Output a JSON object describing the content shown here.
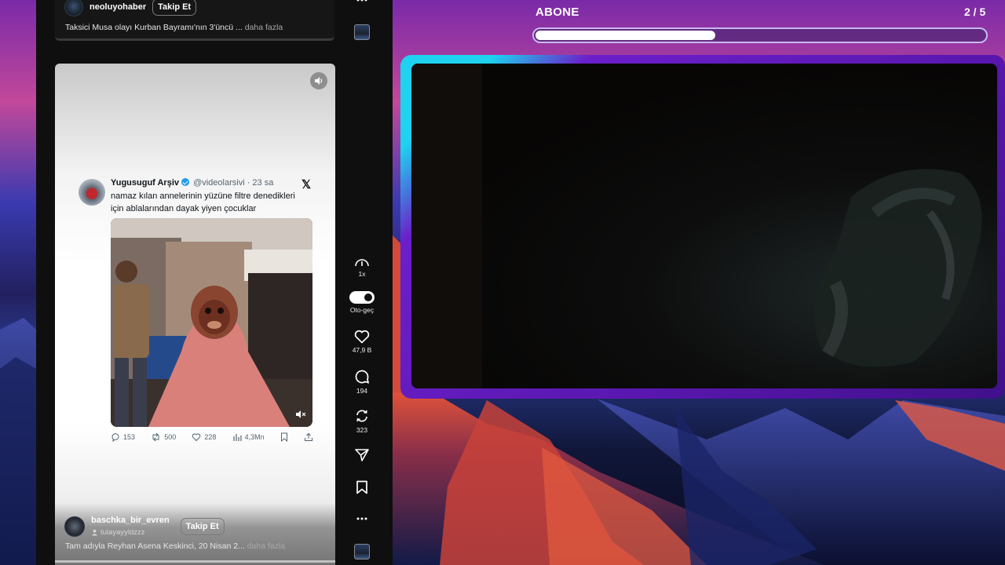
{
  "prev_card": {
    "author": "neoluyohaber",
    "follow_label": "Takip Et",
    "caption": "Taksici Musa olayı Kurban Bayramı'nın 3'üncü ...",
    "more_label": "daha fazla"
  },
  "tweet": {
    "name": "Yugusuguf Arşiv",
    "handle": "@videolarsivi",
    "time": "· 23 sa",
    "text": "namaz kılan annelerinin yüzüne filtre denedikleri için ablalarından dayak yiyen çocuklar",
    "replies": "153",
    "retweets": "500",
    "likes": "228",
    "views": "4,3Mn"
  },
  "next_card": {
    "author": "baschka_bir_evren",
    "sub": "tulayayyldzzz",
    "follow_label": "Takip Et",
    "caption": "Tam adıyla Reyhan Asena Keskinci, 20 Nisan 2...",
    "more_label": "daha fazla"
  },
  "rail": {
    "speed_label": "1x",
    "autoplay_label": "Oto-geç",
    "likes_count": "47,9 B",
    "comments_count": "194",
    "reposts_count": "323",
    "icons": [
      "more-icon",
      "speed-icon",
      "heart-icon",
      "comment-icon",
      "repost-icon",
      "send-icon",
      "bookmark-icon"
    ]
  },
  "overlay": {
    "title": "ABONE",
    "counter": "2 / 5",
    "progress": 0.4
  },
  "colors": {
    "frame_accent": "#1ed2f0",
    "frame_main": "#6b1fc9",
    "verified": "#1d9bf0"
  }
}
